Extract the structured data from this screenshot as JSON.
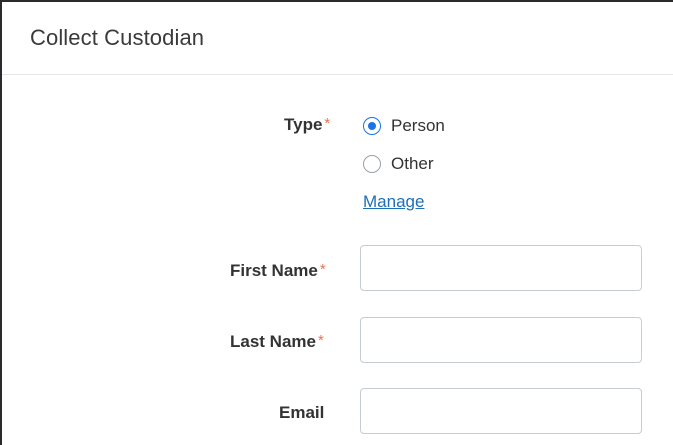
{
  "header": {
    "title": "Collect Custodian"
  },
  "form": {
    "type": {
      "label": "Type",
      "required_marker": "*",
      "options": [
        {
          "label": "Person",
          "selected": true
        },
        {
          "label": "Other",
          "selected": false
        }
      ],
      "manage_link": "Manage"
    },
    "first_name": {
      "label": "First Name",
      "required_marker": "*",
      "value": ""
    },
    "last_name": {
      "label": "Last Name",
      "required_marker": "*",
      "value": ""
    },
    "email": {
      "label": "Email",
      "value": ""
    }
  },
  "colors": {
    "accent": "#1a73e8",
    "link": "#1f6fb5",
    "required": "#e8735a",
    "border": "#c7ccd2"
  }
}
